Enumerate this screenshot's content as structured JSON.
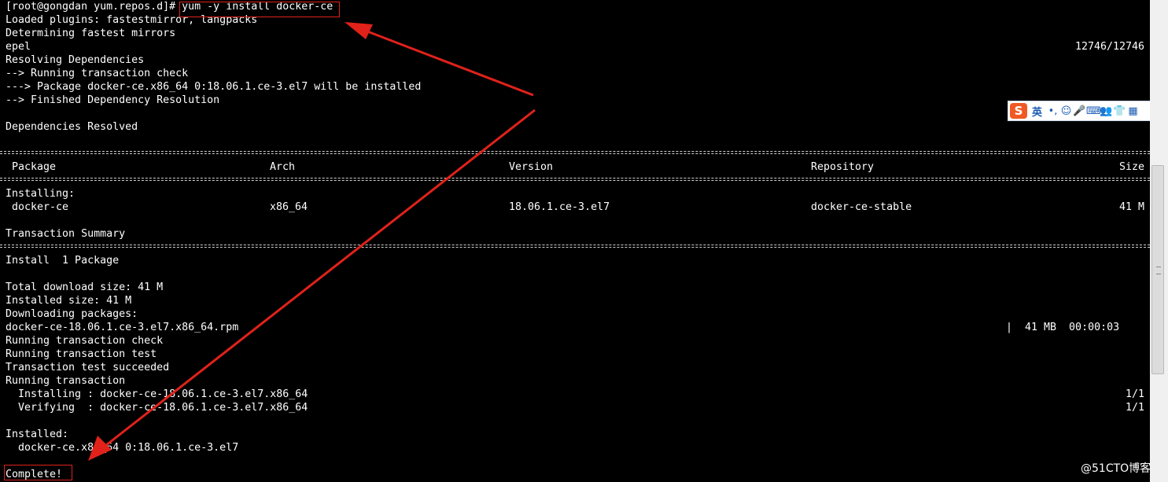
{
  "terminal": {
    "prompt": "[root@gongdan yum.repos.d]# ",
    "command": "yum -y install docker-ce",
    "loaded_plugins": "Loaded plugins: fastestmirror, langpacks",
    "determining": "Determining fastest mirrors",
    "repo_name": "epel",
    "repo_progress": "12746/12746",
    "resolving": "Resolving Dependencies",
    "running_check": "--> Running transaction check",
    "package_line": "---> Package docker-ce.x86_64 0:18.06.1.ce-3.el7 will be installed",
    "finished": "--> Finished Dependency Resolution",
    "deps_resolved": "Dependencies Resolved",
    "table": {
      "headers": {
        "package": "Package",
        "arch": "Arch",
        "version": "Version",
        "repository": "Repository",
        "size": "Size"
      },
      "installing_label": "Installing:",
      "row": {
        "package": "docker-ce",
        "arch": "x86_64",
        "version": "18.06.1.ce-3.el7",
        "repository": "docker-ce-stable",
        "size": "41 M"
      }
    },
    "transaction_summary": "Transaction Summary",
    "install_count": "Install  1 Package",
    "total_download": "Total download size: 41 M",
    "installed_size": "Installed size: 41 M",
    "downloading": "Downloading packages:",
    "rpm_file": "docker-ce-18.06.1.ce-3.el7.x86_64.rpm",
    "rpm_stats": "|  41 MB  00:00:03",
    "running_tx_check": "Running transaction check",
    "running_tx_test": "Running transaction test",
    "tx_test_ok": "Transaction test succeeded",
    "running_tx": "Running transaction",
    "installing_step": "  Installing : docker-ce-18.06.1.ce-3.el7.x86_64",
    "installing_count": "1/1",
    "verifying_step": "  Verifying  : docker-ce-18.06.1.ce-3.el7.x86_64",
    "verifying_count": "1/1",
    "installed_label": "Installed:",
    "installed_pkg": "  docker-ce.x86_64 0:18.06.1.ce-3.el7",
    "complete": "Complete!"
  },
  "ime_toolbar": {
    "logo": "S",
    "mode": "英",
    "glyphs": [
      "•,",
      "☺",
      "🎤",
      "⌨",
      "👥",
      "👕",
      "▦"
    ],
    "icons": [
      "sogou-logo-icon",
      "punctuation-icon",
      "emoji-icon",
      "microphone-icon",
      "keyboard-icon",
      "users-icon",
      "skin-icon",
      "toolbox-icon"
    ]
  },
  "watermark": "@51CTO博客",
  "colors": {
    "background": "#000000",
    "text": "#ffffff",
    "annotation": "#e0221a"
  }
}
